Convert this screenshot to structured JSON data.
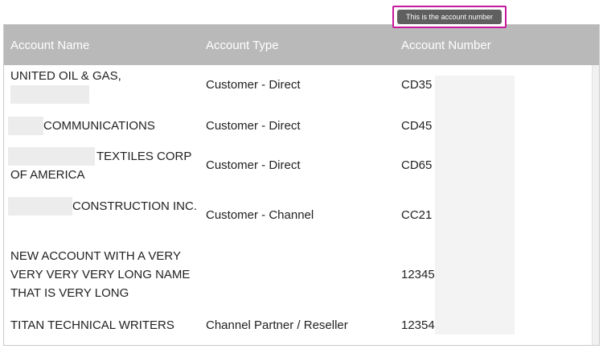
{
  "tooltip": {
    "text": "This is the account number"
  },
  "table": {
    "columns": {
      "name": "Account Name",
      "type": "Account Type",
      "number": "Account Number"
    },
    "rows": [
      {
        "name_parts": [
          "UNITED OIL & GAS,",
          ""
        ],
        "type": "Customer - Direct",
        "number": "CD35"
      },
      {
        "name_parts": [
          "",
          "COMMUNICATIONS"
        ],
        "type": "Customer - Direct",
        "number": "CD45"
      },
      {
        "name_parts": [
          "",
          "TEXTILES CORP OF AMERICA"
        ],
        "type": "Customer - Direct",
        "number": "CD65"
      },
      {
        "name_parts": [
          "",
          "CONSTRUCTION INC."
        ],
        "type": "Customer - Channel",
        "number": "CC21"
      },
      {
        "name_parts": [
          "NEW ACCOUNT WITH A VERY VERY VERY VERY LONG NAME THAT IS VERY LONG"
        ],
        "type": "",
        "number": "12345"
      },
      {
        "name_parts": [
          "TITAN TECHNICAL WRITERS"
        ],
        "type": "Channel Partner / Reseller",
        "number": "12354"
      }
    ]
  }
}
